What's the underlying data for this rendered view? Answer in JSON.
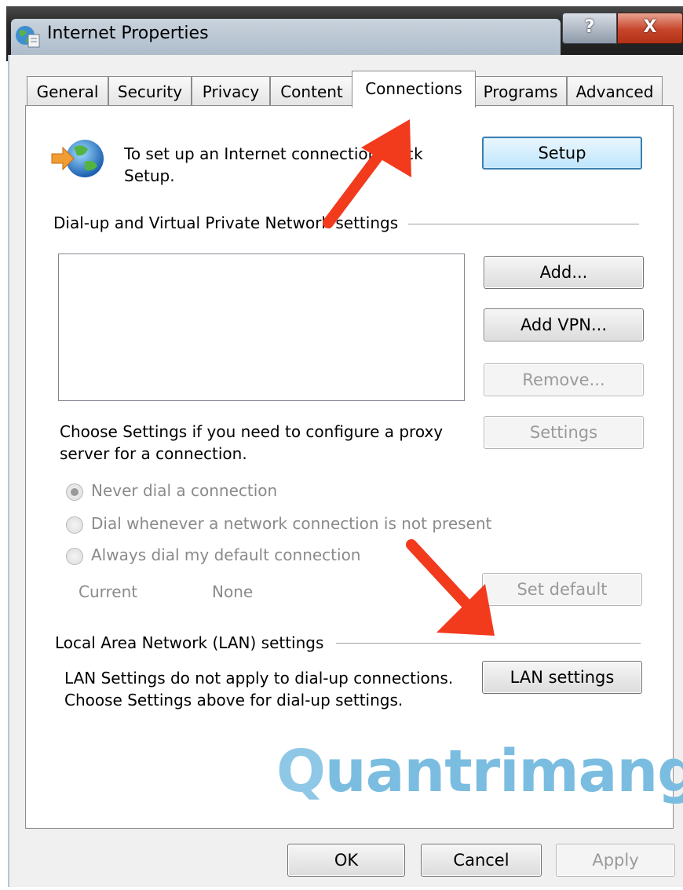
{
  "window": {
    "title": "Internet Properties",
    "help_label": "?",
    "close_label": "X"
  },
  "tabs": [
    {
      "label": "General"
    },
    {
      "label": "Security"
    },
    {
      "label": "Privacy"
    },
    {
      "label": "Content"
    },
    {
      "label": "Connections",
      "active": true
    },
    {
      "label": "Programs"
    },
    {
      "label": "Advanced"
    }
  ],
  "setup": {
    "text_line1": "To set up an Internet connection, click",
    "text_line2": "Setup.",
    "button": "Setup"
  },
  "dialup": {
    "heading": "Dial-up and Virtual Private Network settings",
    "add": "Add...",
    "add_vpn": "Add VPN...",
    "remove": "Remove...",
    "settings": "Settings",
    "proxy_line1": "Choose Settings if you need to configure a proxy",
    "proxy_line2": "server for a connection.",
    "options": [
      {
        "label": "Never dial a connection",
        "selected": true
      },
      {
        "label": "Dial whenever a network connection is not present",
        "selected": false
      },
      {
        "label": "Always dial my default connection",
        "selected": false
      }
    ],
    "current_label": "Current",
    "current_value": "None",
    "set_default": "Set default"
  },
  "lan": {
    "heading": "Local Area Network (LAN) settings",
    "text_line1": "LAN Settings do not apply to dial-up connections.",
    "text_line2": "Choose Settings above for dial-up settings.",
    "button": "LAN settings"
  },
  "footer": {
    "ok": "OK",
    "cancel": "Cancel",
    "apply": "Apply"
  },
  "watermark": {
    "first": "Q",
    "rest": "uantrimang"
  },
  "colors": {
    "annotation_arrow": "#f23a1d",
    "default_button_border": "#3c7fb1",
    "watermark": "#8fc7e6"
  }
}
